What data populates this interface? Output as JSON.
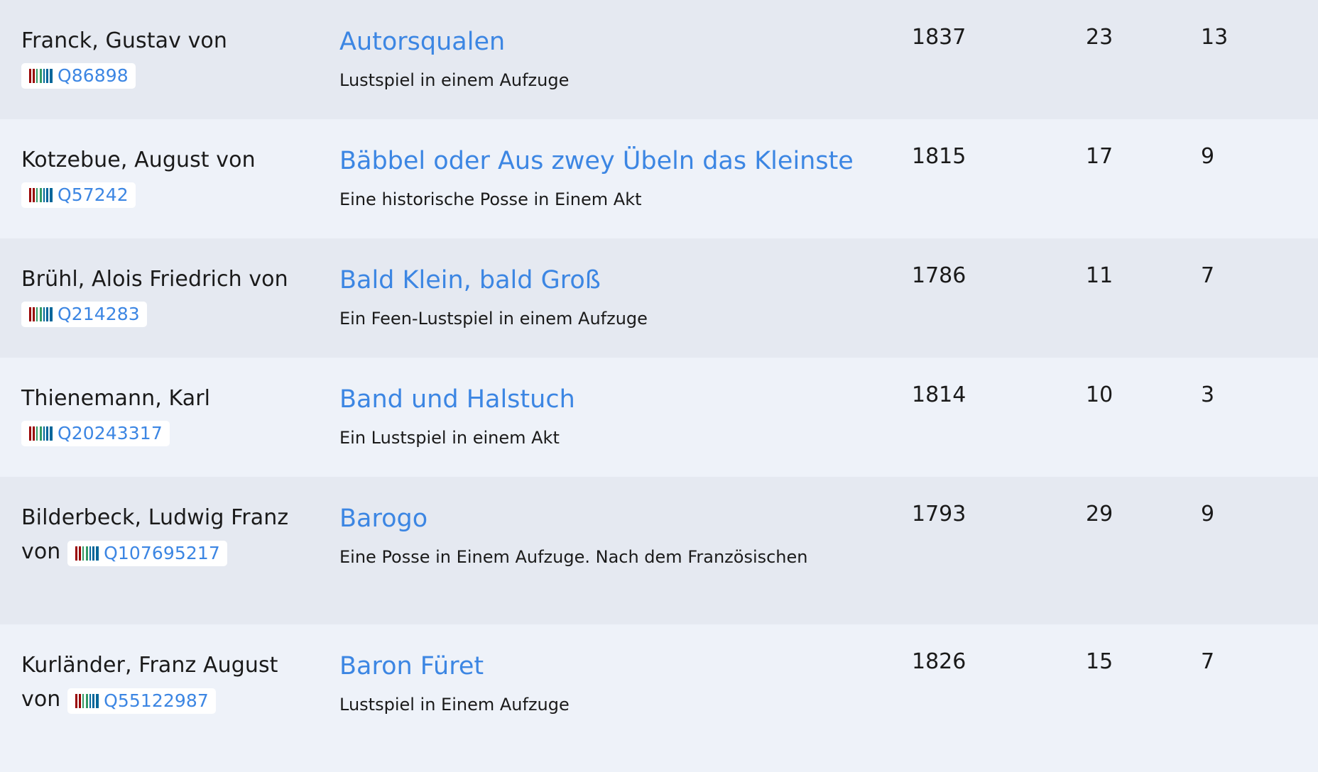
{
  "rows": [
    {
      "author": "Franck, Gustav von",
      "wikidata": "Q86898",
      "title": "Autorsqualen",
      "subtitle": "Lustspiel in einem Aufzuge",
      "year": "1837",
      "count_a": "23",
      "count_b": "13"
    },
    {
      "author": "Kotzebue, August von",
      "wikidata": "Q57242",
      "title": "Bäbbel oder Aus zwey Übeln das Kleinste",
      "subtitle": "Eine historische Posse in Einem Akt",
      "year": "1815",
      "count_a": "17",
      "count_b": "9"
    },
    {
      "author": "Brühl, Alois Friedrich von",
      "wikidata": "Q214283",
      "title": "Bald Klein, bald Groß",
      "subtitle": "Ein Feen-Lustspiel in einem Aufzuge",
      "year": "1786",
      "count_a": "11",
      "count_b": "7"
    },
    {
      "author": "Thienemann, Karl",
      "wikidata": "Q20243317",
      "title": "Band und Halstuch",
      "subtitle": "Ein Lustspiel in einem Akt",
      "year": "1814",
      "count_a": "10",
      "count_b": "3"
    },
    {
      "author": "Bilderbeck, Ludwig Franz von",
      "wikidata": "Q107695217",
      "title": "Barogo",
      "subtitle": "Eine Posse in Einem Aufzuge. Nach dem Französischen",
      "year": "1793",
      "count_a": "29",
      "count_b": "9"
    },
    {
      "author": "Kurländer, Franz August von",
      "wikidata": "Q55122987",
      "title": "Baron Füret",
      "subtitle": "Lustspiel in Einem Aufzuge",
      "year": "1826",
      "count_a": "15",
      "count_b": "7"
    }
  ],
  "icons": {
    "wikidata": "wikidata-logo-icon"
  },
  "colors": {
    "link": "#3c86e3",
    "row_odd": "#e5e9f1",
    "row_even": "#eef2f9",
    "badge_bg": "#ffffff"
  }
}
